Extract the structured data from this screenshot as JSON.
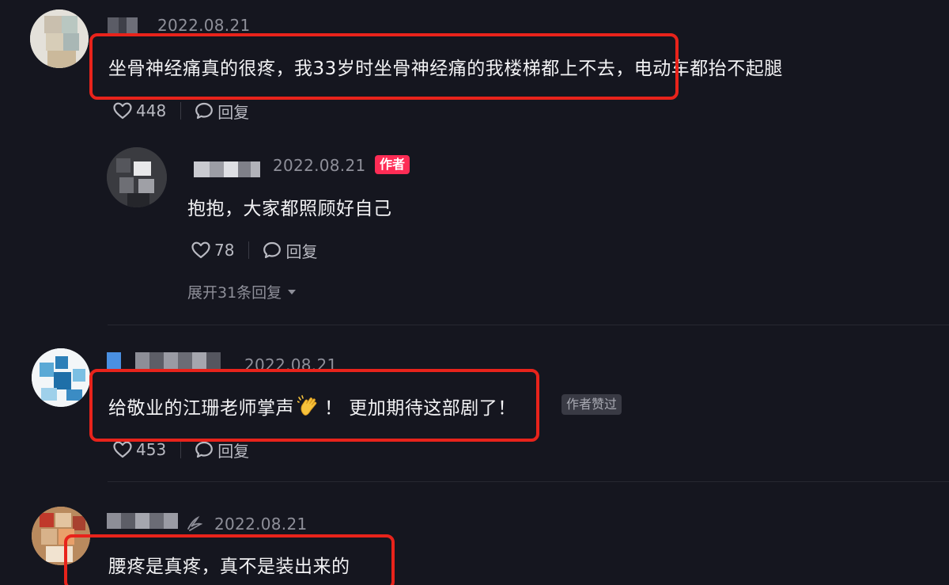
{
  "comments": [
    {
      "date": "2022.08.21",
      "text": "坐骨神经痛真的很疼，我33岁时坐骨神经痛的我楼梯都上不去，电动车都抬不起腿",
      "likes": "448",
      "reply_label": "回复"
    },
    {
      "date": "2022.08.21",
      "author_badge": "作者",
      "text": "抱抱，大家都照顾好自己",
      "likes": "78",
      "reply_label": "回复",
      "expand_label": "展开31条回复"
    },
    {
      "date": "2022.08.21",
      "text_before": "给敬业的江珊老师掌声",
      "emoji": "clapping-hands",
      "text_after": "！ 更加期待这部剧了！",
      "liked_badge": "作者赞过",
      "likes": "453",
      "reply_label": "回复"
    },
    {
      "date": "2022.08.21",
      "text": "腰疼是真疼，真不是装出来的"
    }
  ],
  "colors": {
    "background": "#15161f",
    "highlight": "#e8231b",
    "author_badge": "#fe2c55"
  }
}
